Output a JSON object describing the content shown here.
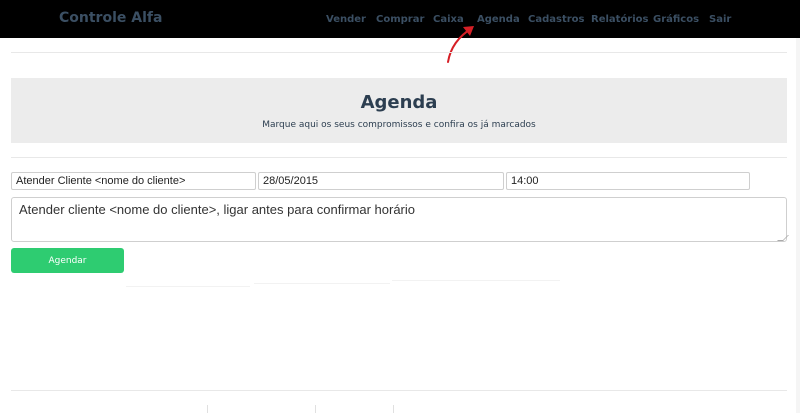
{
  "navbar": {
    "brand": "Controle Alfa",
    "items": [
      {
        "label": "Vender"
      },
      {
        "label": "Comprar"
      },
      {
        "label": "Caixa"
      },
      {
        "label": "Agenda"
      },
      {
        "label": "Cadastros"
      },
      {
        "label": "Relatórios"
      },
      {
        "label": "Gráficos"
      },
      {
        "label": "Sair"
      }
    ]
  },
  "jumbotron": {
    "title": "Agenda",
    "subtitle": "Marque aqui os seus compromissos e confira os já marcados"
  },
  "form": {
    "title_value": "Atender Cliente <nome do cliente>",
    "date_value": "28/05/2015",
    "time_value": "14:00",
    "description_value": "Atender cliente <nome do cliente>, ligar antes para confirmar horário",
    "submit_label": "Agendar"
  },
  "colors": {
    "navbar_bg": "#000000",
    "nav_text": "#3b4f63",
    "jumbotron_bg": "#ececec",
    "button_bg": "#2ecc71",
    "annotation_arrow": "#d61f26"
  },
  "icons": {
    "annotation": "red-arrow-icon"
  }
}
